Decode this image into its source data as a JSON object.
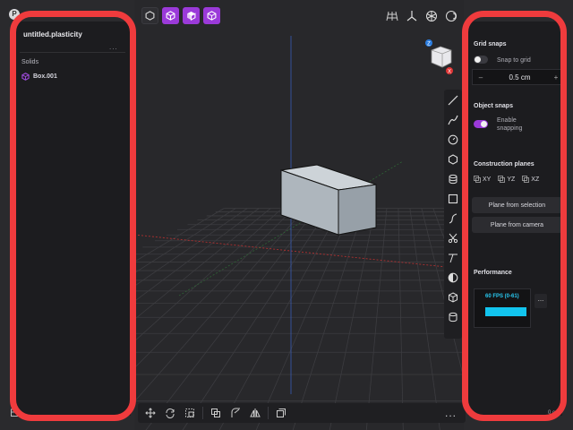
{
  "app": {
    "logo_letter": "P"
  },
  "left_panel": {
    "file_title": "untitled.plasticity",
    "more": "...",
    "section_label": "Solids",
    "items": [
      {
        "label": "Box.001"
      }
    ]
  },
  "viewport": {
    "top_tools": [
      {
        "icon": "hexagon-outline-icon",
        "active": false
      },
      {
        "icon": "cube-solid-icon",
        "active": true
      },
      {
        "icon": "cube-faces-icon",
        "active": true
      },
      {
        "icon": "cube-shaded-icon",
        "active": true
      }
    ],
    "right_tools": [
      "grid-icon",
      "axes-icon",
      "settings-icon",
      "render-mode-icon"
    ],
    "nav_cube": {
      "top_badge": "Z",
      "bottom_badge": "X"
    },
    "vertical_tools": [
      "line-icon",
      "curve-icon",
      "circle-icon",
      "polygon-icon",
      "cylinder-icon",
      "rectangle-icon",
      "spline-icon",
      "scissors-icon",
      "trim-icon",
      "circle-half-icon",
      "box-icon",
      "drum-icon"
    ],
    "bottom_tools": [
      "move-icon",
      "rotate-icon",
      "scale-icon",
      "boolean-icon",
      "fillet-icon",
      "mirror-icon",
      "duplicate-icon"
    ],
    "bottom_more": "...",
    "colors": {
      "grid": "#3c3c40",
      "x_axis": "#b03030",
      "y_axis": "#2f6a36",
      "z_axis": "#3a63c8",
      "box_face": "#b8c0c8"
    }
  },
  "right_panel": {
    "grid_snaps": {
      "heading": "Grid snaps",
      "toggle_label": "Snap to grid",
      "enabled": false,
      "step_value": "0.5 cm",
      "minus": "–",
      "plus": "+"
    },
    "object_snaps": {
      "heading": "Object snaps",
      "toggle_label_line1": "Enable",
      "toggle_label_line2": "snapping",
      "enabled": true
    },
    "construction_planes": {
      "heading": "Construction planes",
      "planes": [
        "XY",
        "YZ",
        "XZ"
      ],
      "plane_from_selection": "Plane from selection",
      "plane_from_camera": "Plane from camera"
    },
    "performance": {
      "heading": "Performance",
      "fps_label": "60 FPS (0-61)",
      "more": "..."
    }
  },
  "status": {
    "right_text": "0 cm"
  },
  "accent_color": "#9b3ad9",
  "highlight_color": "#ef3b3d"
}
